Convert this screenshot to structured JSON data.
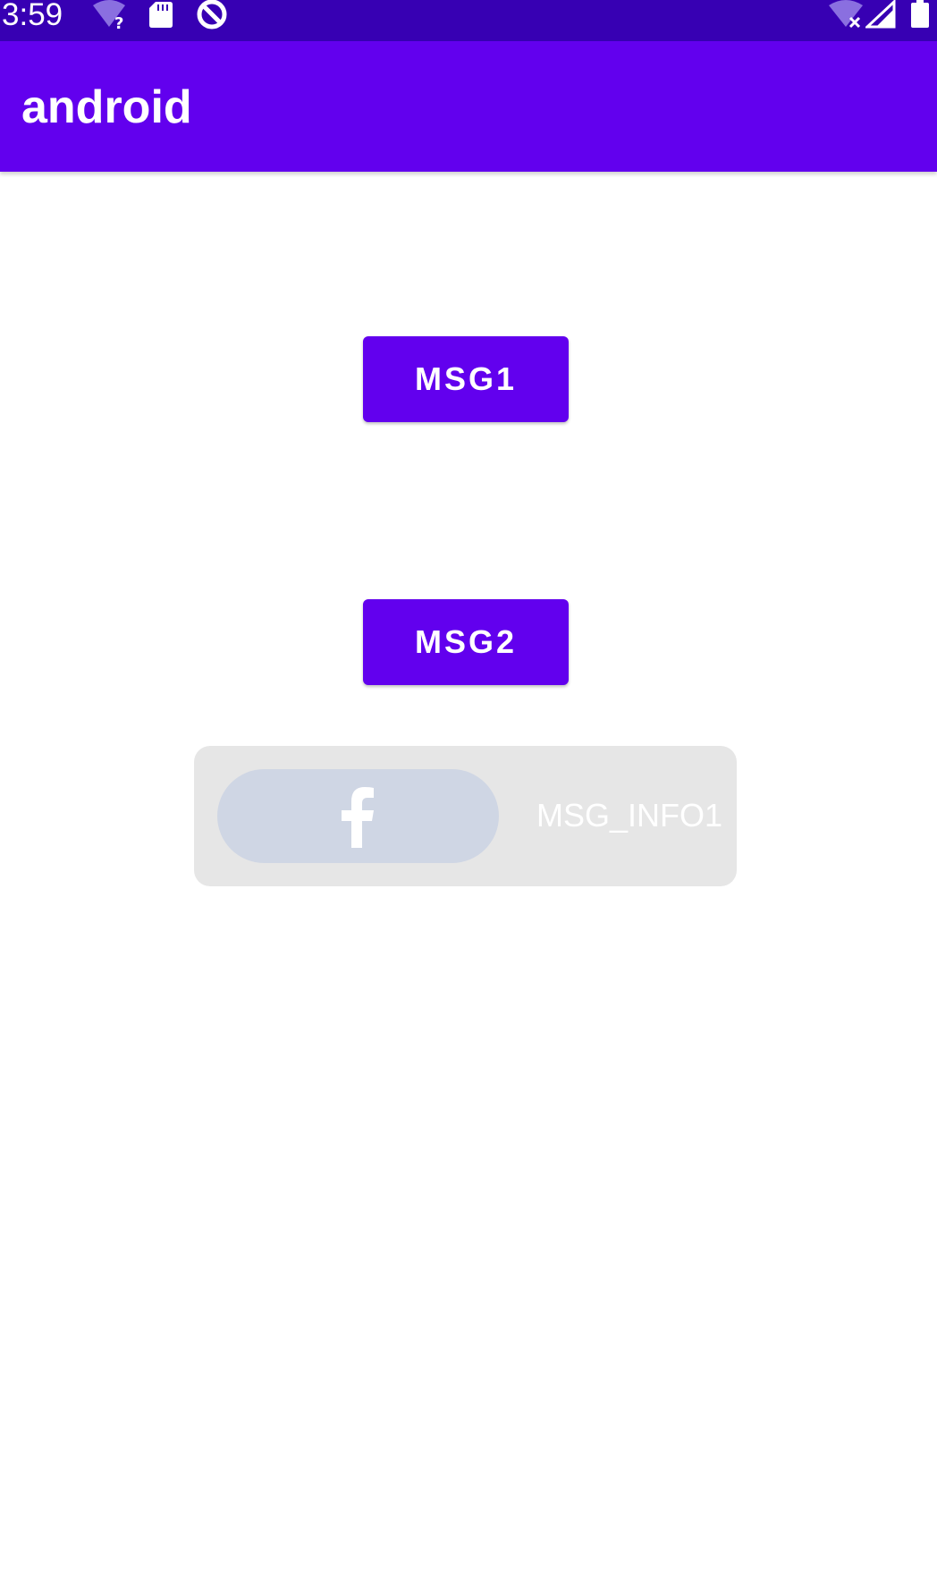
{
  "status_bar": {
    "time": "3:59",
    "icons": [
      "wifi-unknown-icon",
      "sd-card-icon",
      "data-saver-icon",
      "wifi-off-icon",
      "signal-icon",
      "battery-icon"
    ],
    "background": "#3700b3"
  },
  "app_bar": {
    "title": "android",
    "background": "#6200ee"
  },
  "main": {
    "button1_label": "MSG1",
    "button2_label": "MSG2",
    "info_card": {
      "icon": "facebook-icon",
      "text": "MSG_INFO1",
      "pill_color": "#cfd6e4",
      "card_color": "#e6e6e6"
    }
  },
  "colors": {
    "primary": "#6200ee",
    "primary_dark": "#3700b3"
  }
}
